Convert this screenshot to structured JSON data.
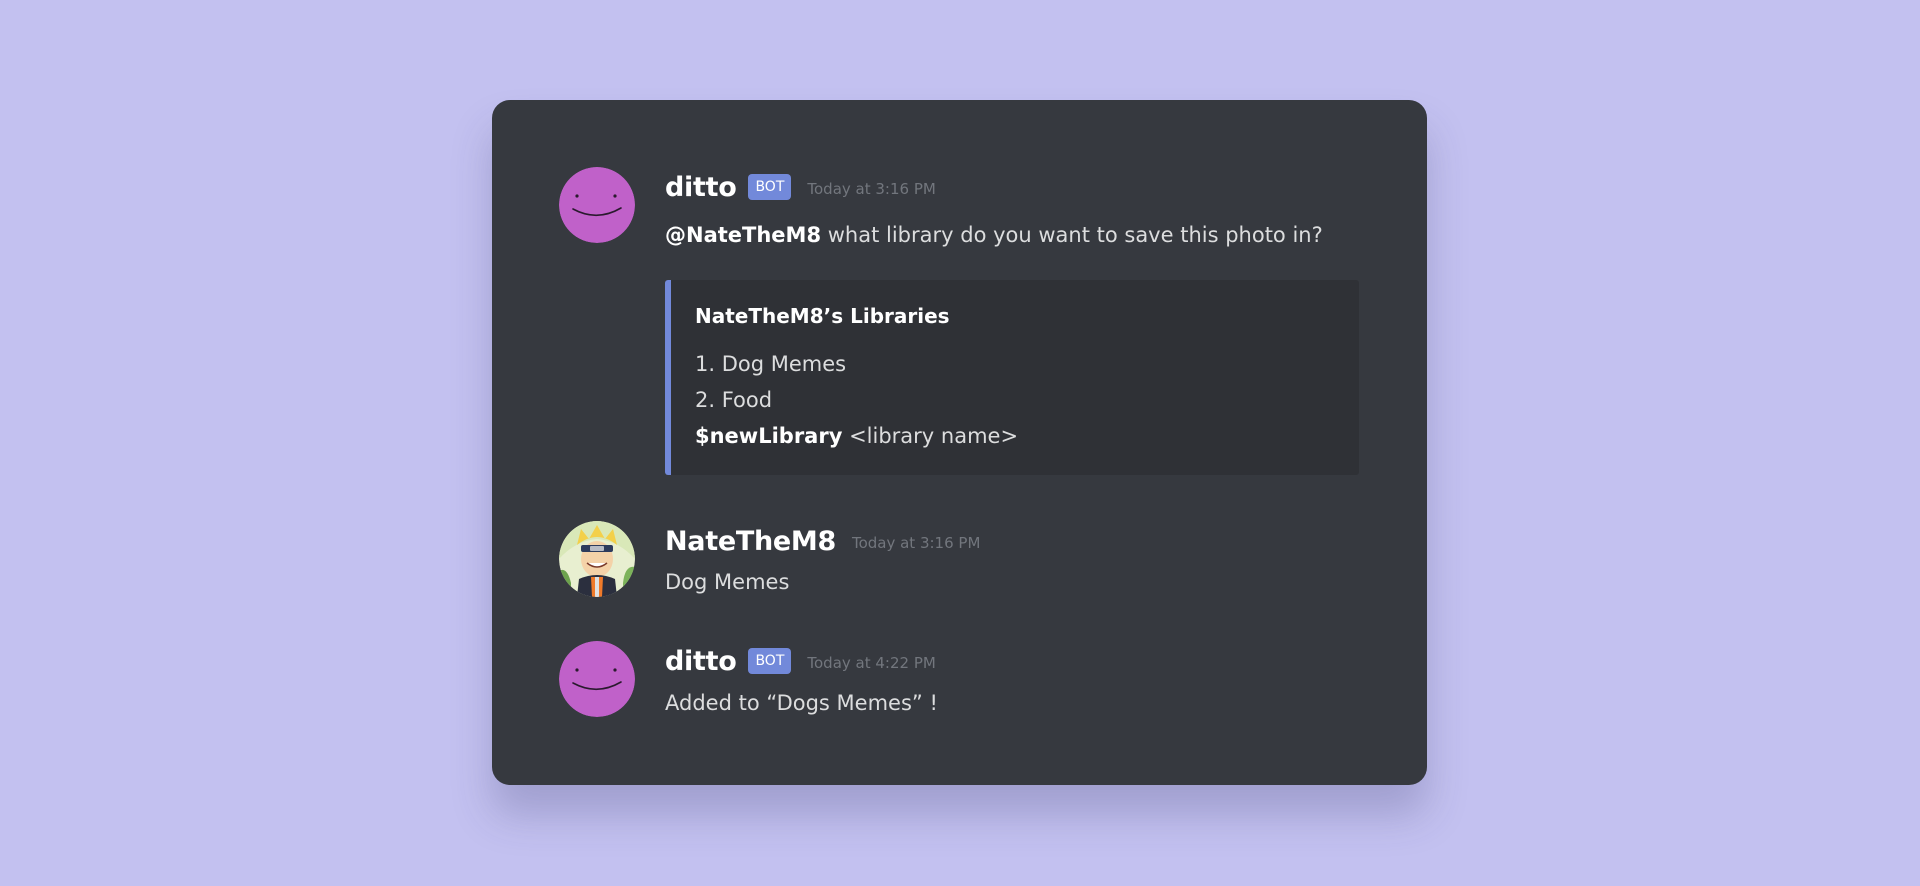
{
  "colors": {
    "page_background": "#c3c1f0",
    "card_background": "#36393f",
    "embed_background": "#2f3136",
    "accent": "#7289da",
    "ditto_avatar": "#c061c9"
  },
  "messages": [
    {
      "username": "ditto",
      "badge": "BOT",
      "timestamp": "Today at 3:16 PM",
      "mention": "@NateTheM8",
      "text": " what library do you want to save this photo in?",
      "avatar_icon": "ditto-face-icon",
      "embed": {
        "title": "NateTheM8’s Libraries",
        "items": [
          "1. Dog Memes",
          "2. Food"
        ],
        "command": "$newLibrary",
        "command_arg": " <library name>"
      }
    },
    {
      "username": "NateTheM8",
      "timestamp": "Today at 3:16 PM",
      "text": "Dog Memes",
      "avatar_icon": "naruto-avatar-icon"
    },
    {
      "username": "ditto",
      "badge": "BOT",
      "timestamp": "Today at 4:22 PM",
      "text": "Added to “Dogs Memes” !",
      "avatar_icon": "ditto-face-icon"
    }
  ]
}
